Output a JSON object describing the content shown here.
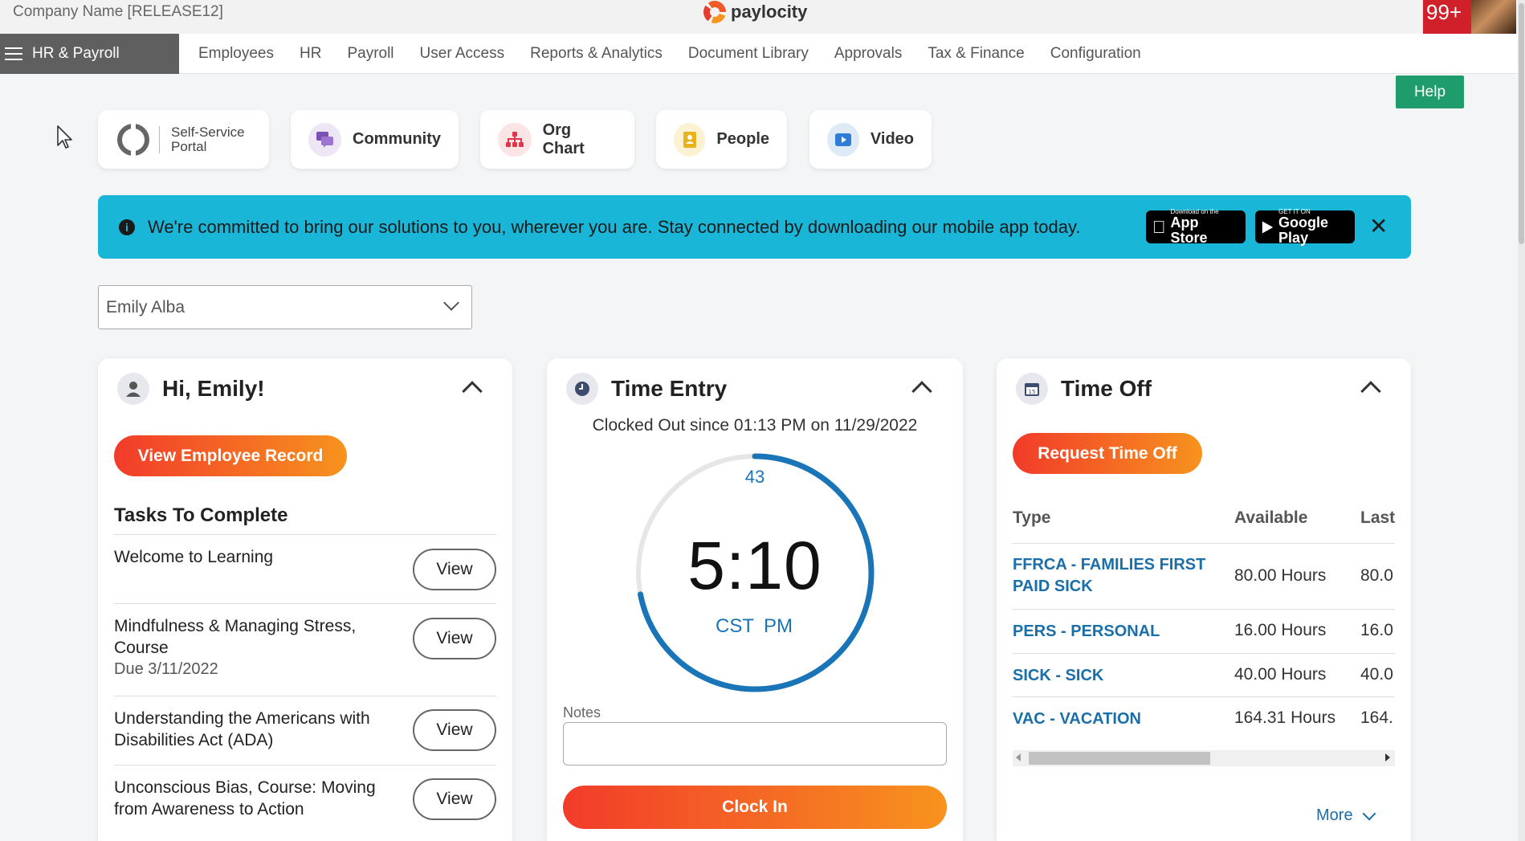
{
  "header": {
    "company": "Company Name [RELEASE12]",
    "logo_text": "paylocity",
    "notifications": "99+"
  },
  "nav": {
    "module": "HR & Payroll",
    "items": [
      "Employees",
      "HR",
      "Payroll",
      "User Access",
      "Reports & Analytics",
      "Document Library",
      "Approvals",
      "Tax & Finance",
      "Configuration"
    ]
  },
  "help_label": "Help",
  "shortcuts": {
    "ssp_line1": "Self-Service",
    "ssp_line2": "Portal",
    "community": "Community",
    "org_chart": "Org Chart",
    "people": "People",
    "video": "Video"
  },
  "banner": {
    "text": "We're committed to bring our solutions to you, wherever you are. Stay connected by downloading our mobile app today.",
    "app_store_small": "Download on the",
    "app_store_large": "App Store",
    "google_small": "GET IT ON",
    "google_large": "Google Play"
  },
  "employee_select": {
    "value": "Emily Alba"
  },
  "greeting_card": {
    "title": "Hi, Emily!",
    "view_record": "View Employee Record",
    "tasks_title": "Tasks To Complete",
    "view_label": "View",
    "tasks": [
      {
        "title": "Welcome to Learning",
        "due": ""
      },
      {
        "title": "Mindfulness & Managing Stress, Course",
        "due": "Due 3/11/2022"
      },
      {
        "title": "Understanding the Americans with Disabilities Act (ADA)",
        "due": ""
      },
      {
        "title": "Unconscious Bias, Course: Moving from Awareness to Action",
        "due": ""
      }
    ]
  },
  "time_entry": {
    "title": "Time Entry",
    "status": "Clocked Out since 01:13 PM on 11/29/2022",
    "seconds": "43",
    "seconds_progress": 0.72,
    "time": "5:10",
    "timezone": "CST",
    "ampm": "PM",
    "notes_label": "Notes",
    "notes_value": "",
    "clock_in": "Clock In"
  },
  "time_off": {
    "title": "Time Off",
    "request": "Request Time Off",
    "columns": {
      "type": "Type",
      "available": "Available",
      "last": "Last"
    },
    "rows": [
      {
        "type": "FFRCA - FAMILIES FIRST PAID SICK",
        "available": "80.00 Hours",
        "last": "80.0"
      },
      {
        "type": "PERS - PERSONAL",
        "available": "16.00 Hours",
        "last": "16.0"
      },
      {
        "type": "SICK - SICK",
        "available": "40.00 Hours",
        "last": "40.0"
      },
      {
        "type": "VAC - VACATION",
        "available": "164.31 Hours",
        "last": "164."
      }
    ],
    "more": "More"
  },
  "colors": {
    "accent_orange_start": "#f23b2a",
    "accent_orange_end": "#f7931e",
    "banner": "#1ab6d8",
    "link_blue": "#1a6fa8",
    "help_green": "#1f9c6b",
    "nav_module": "#5f5f5f"
  },
  "icons": {
    "menu": "hamburger-icon",
    "info": "info-icon",
    "close": "close-icon",
    "user": "user-icon",
    "clock": "clock-icon",
    "calendar": "calendar-icon",
    "chevron": "chevron-down-icon"
  }
}
